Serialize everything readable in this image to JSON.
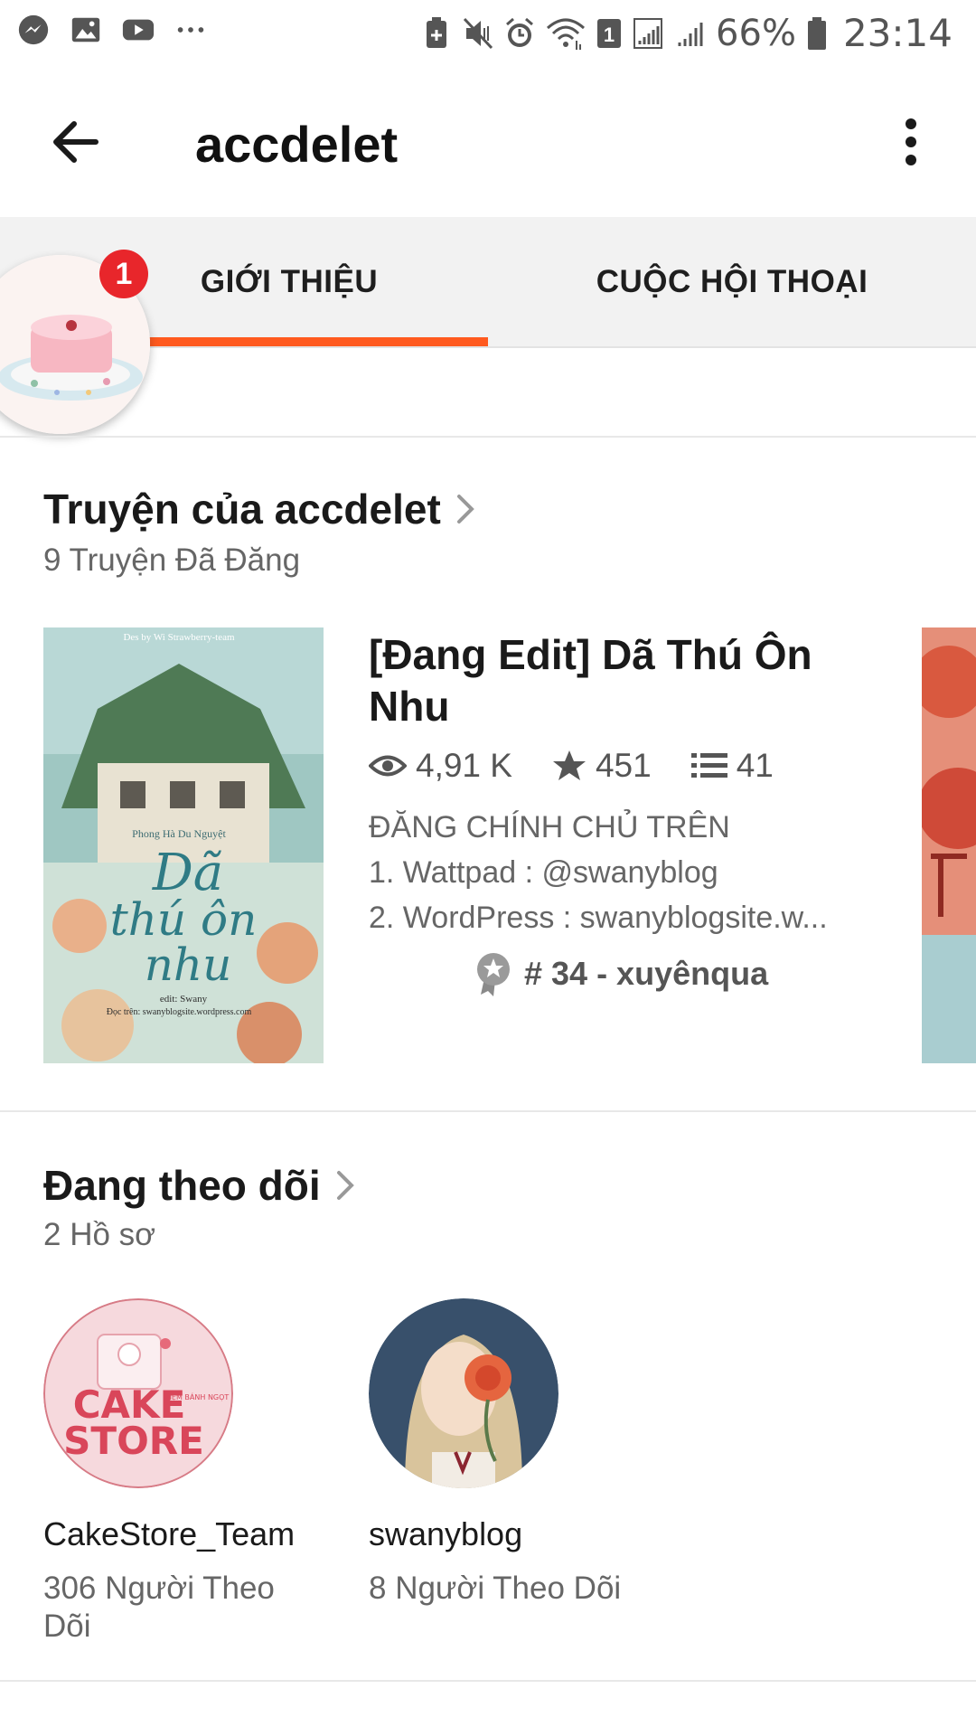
{
  "status_bar": {
    "battery_percent": "66%",
    "time": "23:14",
    "left_icons": [
      "messenger-icon",
      "gallery-icon",
      "youtube-icon",
      "more-dots-icon"
    ],
    "right_icons": [
      "battery-saver-icon",
      "mute-icon",
      "alarm-icon",
      "wifi-icon",
      "sim1-icon",
      "signal-icon",
      "signal-icon",
      "battery-icon"
    ],
    "sim_label": "1"
  },
  "app_bar": {
    "title": "accdelet",
    "back_icon": "arrow-left-icon",
    "menu_icon": "kebab-menu-icon"
  },
  "tabs": {
    "items": [
      {
        "label": "GIỚI THIỆU",
        "active": true
      },
      {
        "label": "CUỘC HỘI THOẠI",
        "active": false
      }
    ],
    "badge_count": "1",
    "accent_color": "#ff5a1f",
    "badge_color": "#e8262b"
  },
  "stories_section": {
    "title": "Truyện của accdelet",
    "subtitle": "9 Truyện Đã Đăng",
    "story": {
      "title": "[Đang Edit] Dã Thú Ôn Nhu",
      "reads": "4,91 K",
      "votes": "451",
      "parts": "41",
      "description_lines": [
        "ĐĂNG CHÍNH CHỦ TRÊN",
        "1. Wattpad : @swanyblog",
        "2. WordPress : swanyblogsite.w..."
      ],
      "rank": "# 34 - xuyênqua",
      "cover_lines": [
        "Des by Wi Strawberry-team",
        "Phong Hà Du Nguyệt",
        "Dã",
        "thú ôn",
        "nhu",
        "edit: Swany",
        "Đọc trên: swanyblogsite.wordpress.com"
      ]
    }
  },
  "following_section": {
    "title": "Đang theo dõi",
    "subtitle": "2 Hồ sơ",
    "profiles": [
      {
        "name": "CakeStore_Team",
        "followers": "306 Người Theo Dõi",
        "logo_lines": [
          "CAKE",
          "STORE",
          "TIỆM BÁNH NGỌT"
        ]
      },
      {
        "name": "swanyblog",
        "followers": "8 Người Theo Dõi"
      }
    ]
  }
}
